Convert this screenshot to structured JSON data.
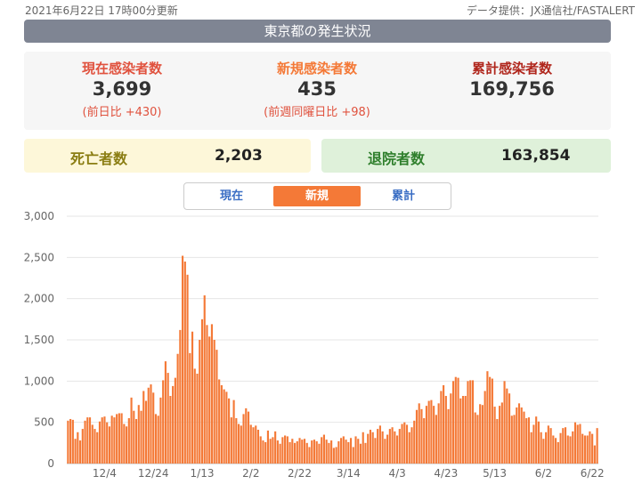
{
  "header": {
    "updated": "2021年6月22日 17時00分更新",
    "source": "データ提供：JX通信社/FASTALERT"
  },
  "title": "東京都の発生状況",
  "stats": {
    "current": {
      "label": "現在感染者数",
      "value": "3,699",
      "sub": "(前日比 +430)"
    },
    "new": {
      "label": "新規感染者数",
      "value": "435",
      "sub": "(前週同曜日比 +98)"
    },
    "total": {
      "label": "累計感染者数",
      "value": "169,756"
    }
  },
  "deaths": {
    "label": "死亡者数",
    "value": "2,203"
  },
  "recovered": {
    "label": "退院者数",
    "value": "163,854"
  },
  "toggle": {
    "current": "現在",
    "new": "新規",
    "total": "累計",
    "active": "new"
  },
  "colors": {
    "bar": "#f47937",
    "current_label": "#e0523e",
    "new_label": "#f47937",
    "total_label": "#b0261c",
    "deaths_bg": "#fdf7d9",
    "deaths_label": "#8a7d12",
    "recovered_bg": "#dff1da",
    "recovered_label": "#2f7f2c"
  },
  "chart_data": {
    "type": "bar",
    "ylim": [
      0,
      3000
    ],
    "yticks": [
      0,
      500,
      1000,
      1500,
      2000,
      2500,
      3000
    ],
    "ytick_labels": [
      "0",
      "500",
      "1,000",
      "1,500",
      "2,000",
      "2,500",
      "3,000"
    ],
    "xtick_labels": [
      "12/4",
      "12/24",
      "1/13",
      "2/2",
      "2/22",
      "3/14",
      "4/3",
      "4/23",
      "5/13",
      "6/2",
      "6/22"
    ],
    "xtick_index": [
      15,
      35,
      55,
      75,
      95,
      115,
      135,
      155,
      175,
      195,
      215
    ],
    "grid": true,
    "series": [
      {
        "values": [
          520,
          540,
          530,
          300,
          380,
          280,
          420,
          520,
          560,
          560,
          470,
          420,
          380,
          510,
          560,
          570,
          500,
          450,
          580,
          560,
          600,
          610,
          610,
          480,
          450,
          550,
          800,
          640,
          540,
          710,
          640,
          880,
          760,
          920,
          960,
          860,
          600,
          580,
          800,
          1010,
          1240,
          1100,
          820,
          940,
          1040,
          1330,
          1620,
          2520,
          2450,
          2290,
          1340,
          1600,
          1150,
          1090,
          1500,
          1750,
          2040,
          1680,
          1540,
          1690,
          1500,
          1380,
          1020,
          950,
          900,
          870,
          790,
          560,
          770,
          550,
          480,
          460,
          600,
          670,
          630,
          470,
          440,
          460,
          410,
          330,
          280,
          260,
          400,
          300,
          320,
          390,
          280,
          240,
          320,
          340,
          330,
          260,
          300,
          250,
          270,
          310,
          290,
          300,
          250,
          200,
          280,
          290,
          270,
          240,
          320,
          350,
          290,
          250,
          280,
          190,
          200,
          270,
          310,
          330,
          290,
          260,
          310,
          200,
          330,
          300,
          240,
          380,
          250,
          360,
          410,
          380,
          310,
          420,
          460,
          390,
          300,
          350,
          420,
          440,
          390,
          340,
          420,
          480,
          500,
          470,
          380,
          440,
          520,
          650,
          730,
          660,
          550,
          700,
          760,
          770,
          700,
          590,
          730,
          880,
          950,
          820,
          660,
          850,
          1000,
          1050,
          1040,
          790,
          820,
          820,
          1000,
          1010,
          1010,
          620,
          590,
          720,
          710,
          880,
          1120,
          1050,
          1030,
          690,
          540,
          700,
          740,
          1000,
          910,
          850,
          580,
          590,
          680,
          730,
          680,
          630,
          550,
          560,
          380,
          470,
          570,
          510,
          380,
          300,
          380,
          460,
          430,
          340,
          310,
          260,
          370,
          430,
          440,
          340,
          330,
          390,
          500,
          470,
          480,
          360,
          340,
          340,
          390,
          360,
          220,
          430
        ]
      }
    ]
  }
}
